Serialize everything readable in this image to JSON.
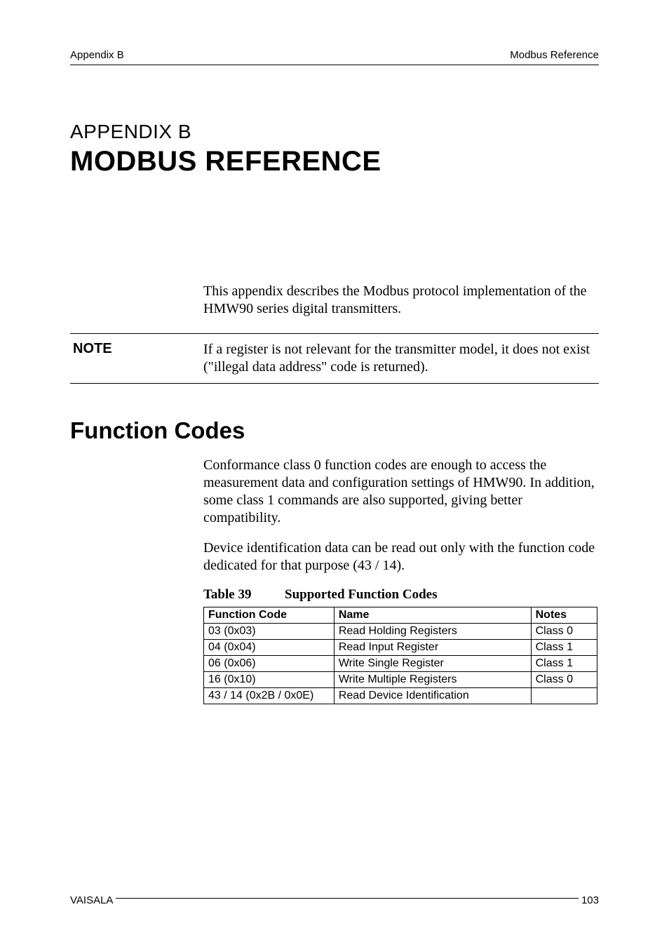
{
  "header": {
    "left": "Appendix B",
    "right": "Modbus Reference"
  },
  "appendix": {
    "label": "APPENDIX B",
    "title": "MODBUS REFERENCE"
  },
  "intro": "This appendix describes the Modbus protocol implementation of the HMW90 series digital transmitters.",
  "note": {
    "label": "NOTE",
    "text": "If a register is not relevant for the transmitter model, it does not exist (\"illegal data address\" code is returned)."
  },
  "section": {
    "heading": "Function Codes",
    "para1": "Conformance class 0 function codes are enough to access the measurement data and configuration settings of HMW90. In addition, some class 1 commands are also supported, giving better compatibility.",
    "para2": "Device identification data can be read out only with the function code dedicated for that purpose (43 / 14)."
  },
  "table": {
    "caption_label": "Table 39",
    "caption_title": "Supported Function Codes",
    "headers": {
      "code": "Function Code",
      "name": "Name",
      "notes": "Notes"
    },
    "rows": [
      {
        "code": "03 (0x03)",
        "name": "Read Holding Registers",
        "notes": "Class 0"
      },
      {
        "code": "04 (0x04)",
        "name": "Read Input Register",
        "notes": "Class 1"
      },
      {
        "code": "06 (0x06)",
        "name": "Write Single Register",
        "notes": "Class 1"
      },
      {
        "code": "16 (0x10)",
        "name": "Write Multiple Registers",
        "notes": "Class 0"
      },
      {
        "code": "43 / 14 (0x2B / 0x0E)",
        "name": "Read Device Identification",
        "notes": ""
      }
    ]
  },
  "footer": {
    "left": "VAISALA",
    "right": "103"
  }
}
